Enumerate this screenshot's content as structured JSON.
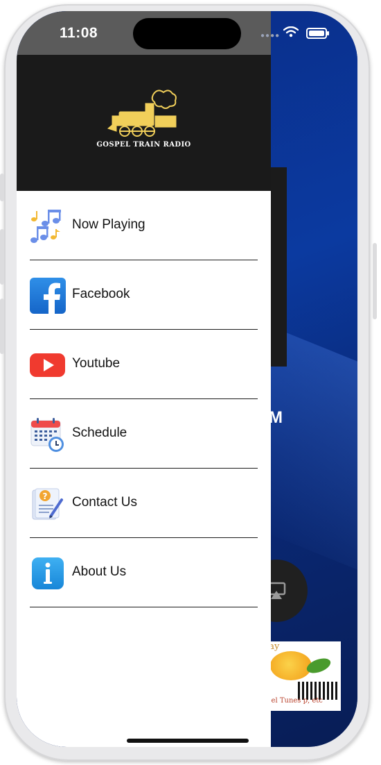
{
  "status_bar": {
    "time": "11:08"
  },
  "drawer": {
    "brand": "GOSPEL TRAIN RADIO",
    "items": [
      {
        "label": "Now Playing",
        "icon": "music-notes-icon"
      },
      {
        "label": "Facebook",
        "icon": "facebook-icon"
      },
      {
        "label": "Youtube",
        "icon": "youtube-icon"
      },
      {
        "label": "Schedule",
        "icon": "calendar-clock-icon"
      },
      {
        "label": "Contact Us",
        "icon": "contact-form-icon"
      },
      {
        "label": "About Us",
        "icon": "info-icon"
      }
    ]
  },
  "background": {
    "partial_text": "M",
    "ad_text_top": "ray",
    "ad_text_bottom": "spel Tunes\np, etc"
  },
  "colors": {
    "drawer_header": "#1a1a1a",
    "status_bar_left": "#5b5b5b",
    "background_blue": "#0b3aa0"
  }
}
